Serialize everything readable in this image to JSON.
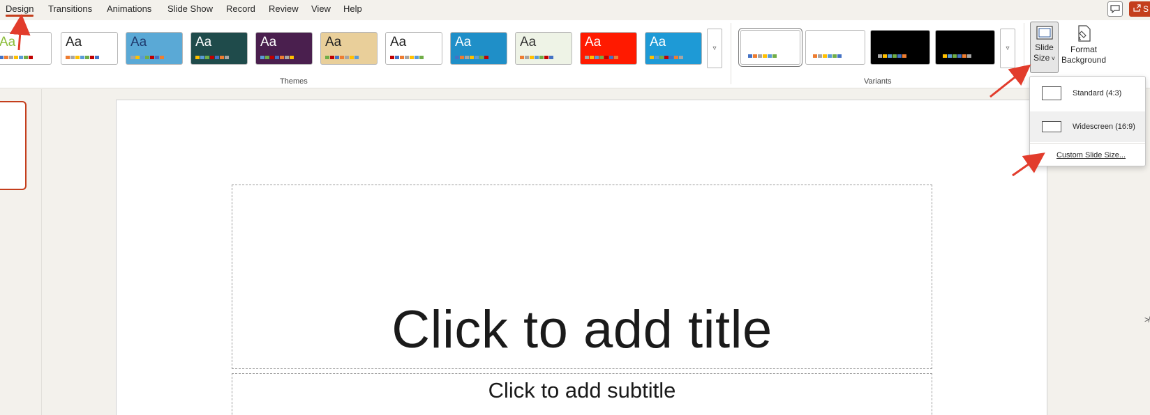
{
  "tabs": [
    {
      "label": "Design",
      "active": true
    },
    {
      "label": "Transitions"
    },
    {
      "label": "Animations"
    },
    {
      "label": "Slide Show"
    },
    {
      "label": "Record"
    },
    {
      "label": "Review"
    },
    {
      "label": "View"
    },
    {
      "label": "Help"
    }
  ],
  "top_right": {
    "comments_icon": "comment-icon",
    "share_label": "S"
  },
  "themes": {
    "label": "Themes",
    "items": [
      {
        "aa": "Aa",
        "aa_color": "#8bbd3a",
        "bg": "#ffffff"
      },
      {
        "aa": "Aa",
        "aa_color": "#222222",
        "bg": "#ffffff"
      },
      {
        "aa": "Aa",
        "aa_color": "#1f3b6e",
        "bg": "#5aa9d6"
      },
      {
        "aa": "Aa",
        "aa_color": "#ffffff",
        "bg": "#1f4b4b"
      },
      {
        "aa": "Aa",
        "aa_color": "#ffffff",
        "bg": "#4a1f4e"
      },
      {
        "aa": "Aa",
        "aa_color": "#222222",
        "bg": "#e9cf9a"
      },
      {
        "aa": "Aa",
        "aa_color": "#222222",
        "bg": "#ffffff"
      },
      {
        "aa": "Aa",
        "aa_color": "#ffffff",
        "bg": "#1f8fc8"
      },
      {
        "aa": "Aa",
        "aa_color": "#333333",
        "bg": "#eef3e6"
      },
      {
        "aa": "Aa",
        "aa_color": "#ffffff",
        "bg": "#ff1a00"
      },
      {
        "aa": "Aa",
        "aa_color": "#ffffff",
        "bg": "#1e9ad6"
      }
    ]
  },
  "variants": {
    "label": "Variants",
    "items": [
      {
        "style": "light",
        "selected": true
      },
      {
        "style": "light"
      },
      {
        "style": "dark"
      },
      {
        "style": "dark"
      }
    ]
  },
  "slide_size_button": {
    "line1": "Slide",
    "line2": "Size"
  },
  "format_background_button": {
    "line1": "Format",
    "line2": "Background"
  },
  "slide_size_menu": {
    "standard": "Standard (4:3)",
    "widescreen": "Widescreen (16:9)",
    "custom": "Custom Slide Size..."
  },
  "slide": {
    "title_placeholder": "Click to add title",
    "subtitle_placeholder": "Click to add subtitle"
  }
}
